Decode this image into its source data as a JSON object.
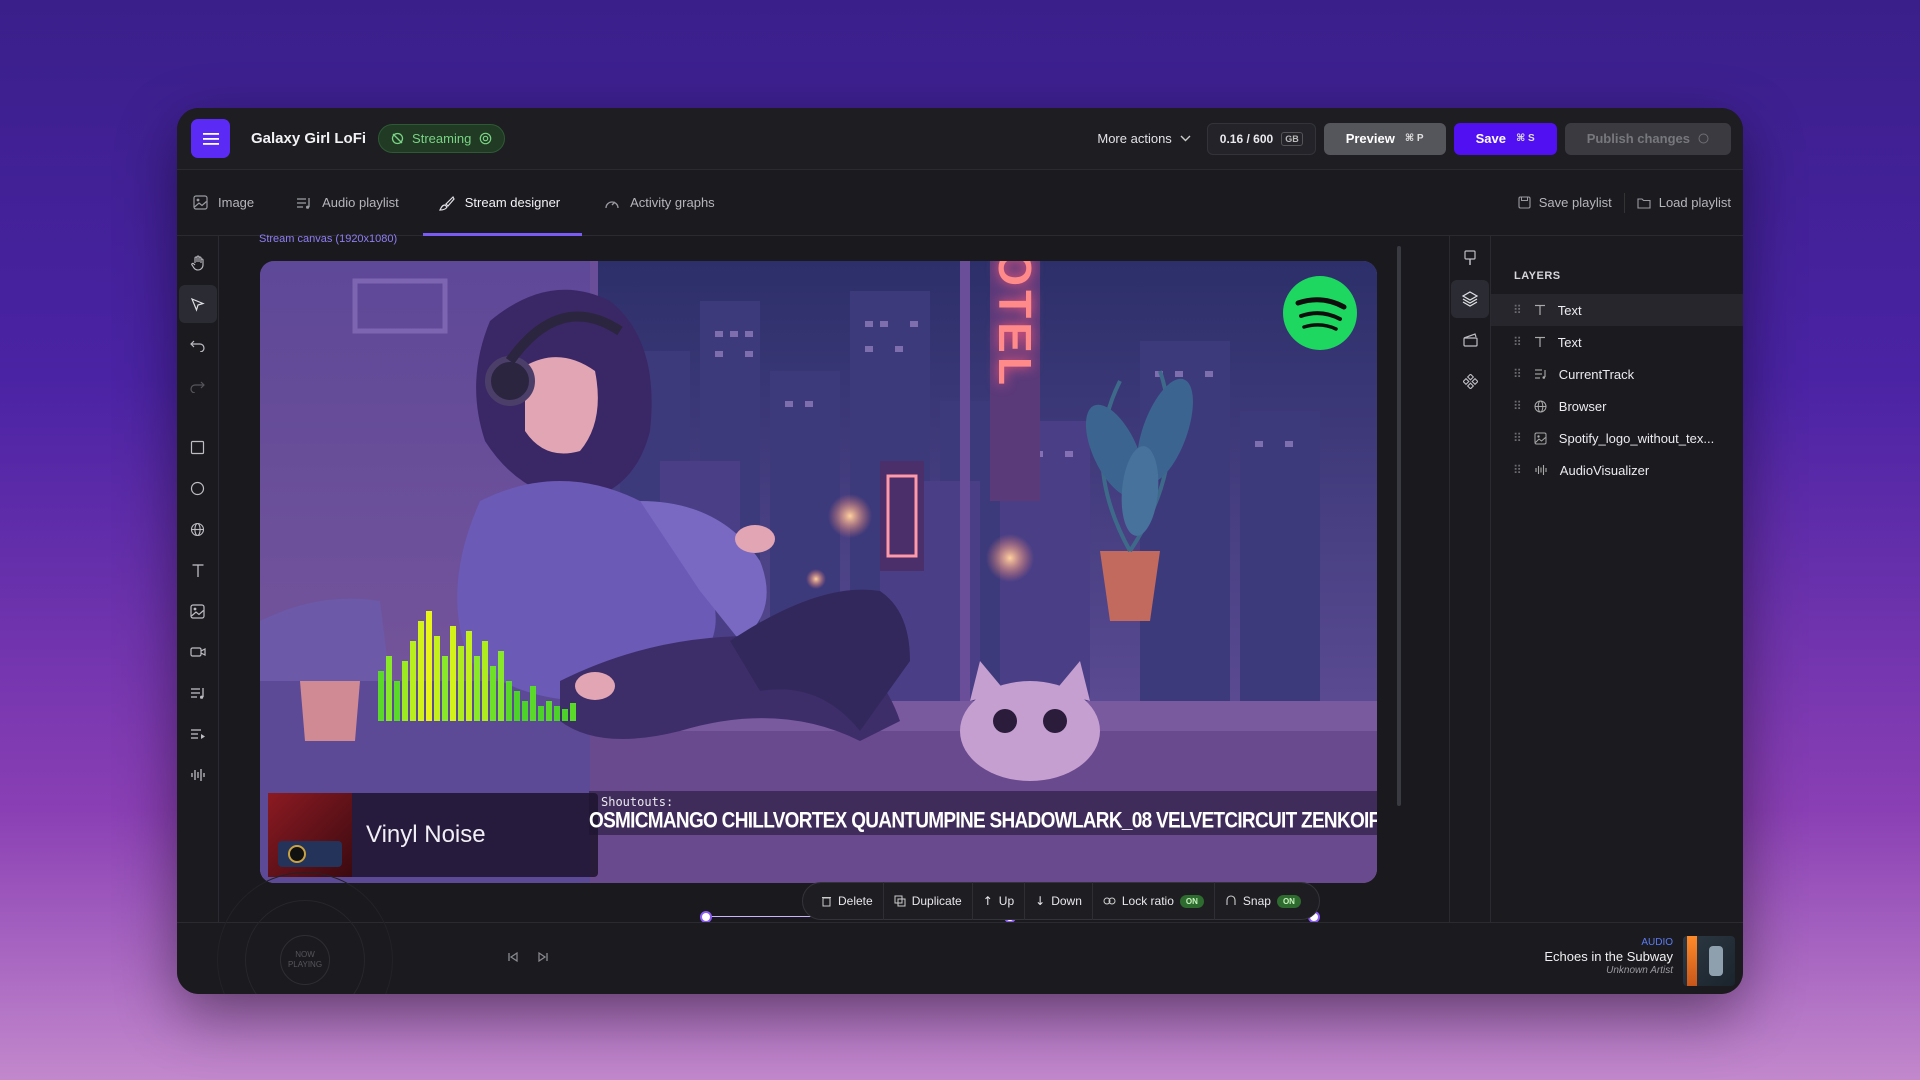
{
  "header": {
    "app_title": "Galaxy Girl LoFi",
    "status_label": "Streaming",
    "more_actions_label": "More actions",
    "storage_usage": "0.16 / 600",
    "storage_unit": "GB",
    "preview_label": "Preview",
    "preview_shortcut": "⌘ P",
    "save_label": "Save",
    "save_shortcut": "⌘ S",
    "publish_label": "Publish changes"
  },
  "tabs": [
    {
      "label": "Image",
      "icon": "image-icon"
    },
    {
      "label": "Audio playlist",
      "icon": "playlist-icon"
    },
    {
      "label": "Stream designer",
      "icon": "brush-icon",
      "active": true
    },
    {
      "label": "Activity graphs",
      "icon": "gauge-icon"
    }
  ],
  "tab_actions": {
    "save_playlist": "Save playlist",
    "load_playlist": "Load playlist"
  },
  "canvas": {
    "label": "Stream canvas (1920x1080)",
    "shoutouts_label": "Shoutouts:",
    "shoutouts_ticker": "OSMICMANGO CHILLVORTEX QUANTUMPINE SHADOWLARK_08 VELVETCIRCUIT ZENKOIFLOW ORE",
    "track_overlay": "Vinyl Noise",
    "hotel_sign": "HOTEL"
  },
  "selection_toolbar": {
    "delete": "Delete",
    "duplicate": "Duplicate",
    "up": "Up",
    "down": "Down",
    "lock_ratio": "Lock ratio",
    "lock_ratio_state": "ON",
    "snap": "Snap",
    "snap_state": "ON"
  },
  "layers": {
    "title": "LAYERS",
    "items": [
      {
        "label": "Text",
        "icon": "text-icon"
      },
      {
        "label": "Text",
        "icon": "text-icon"
      },
      {
        "label": "CurrentTrack",
        "icon": "playlist-icon"
      },
      {
        "label": "Browser",
        "icon": "globe-icon"
      },
      {
        "label": "Spotify_logo_without_tex...",
        "icon": "image-icon"
      },
      {
        "label": "AudioVisualizer",
        "icon": "waveform-icon"
      }
    ]
  },
  "player": {
    "now_playing": "NOW PLAYING",
    "audio_tag": "AUDIO",
    "track_title": "Echoes in the Subway",
    "track_artist": "Unknown Artist"
  },
  "colors": {
    "accent": "#5010f2",
    "streaming_green": "#7ad384",
    "selection": "#8b5cf6"
  }
}
